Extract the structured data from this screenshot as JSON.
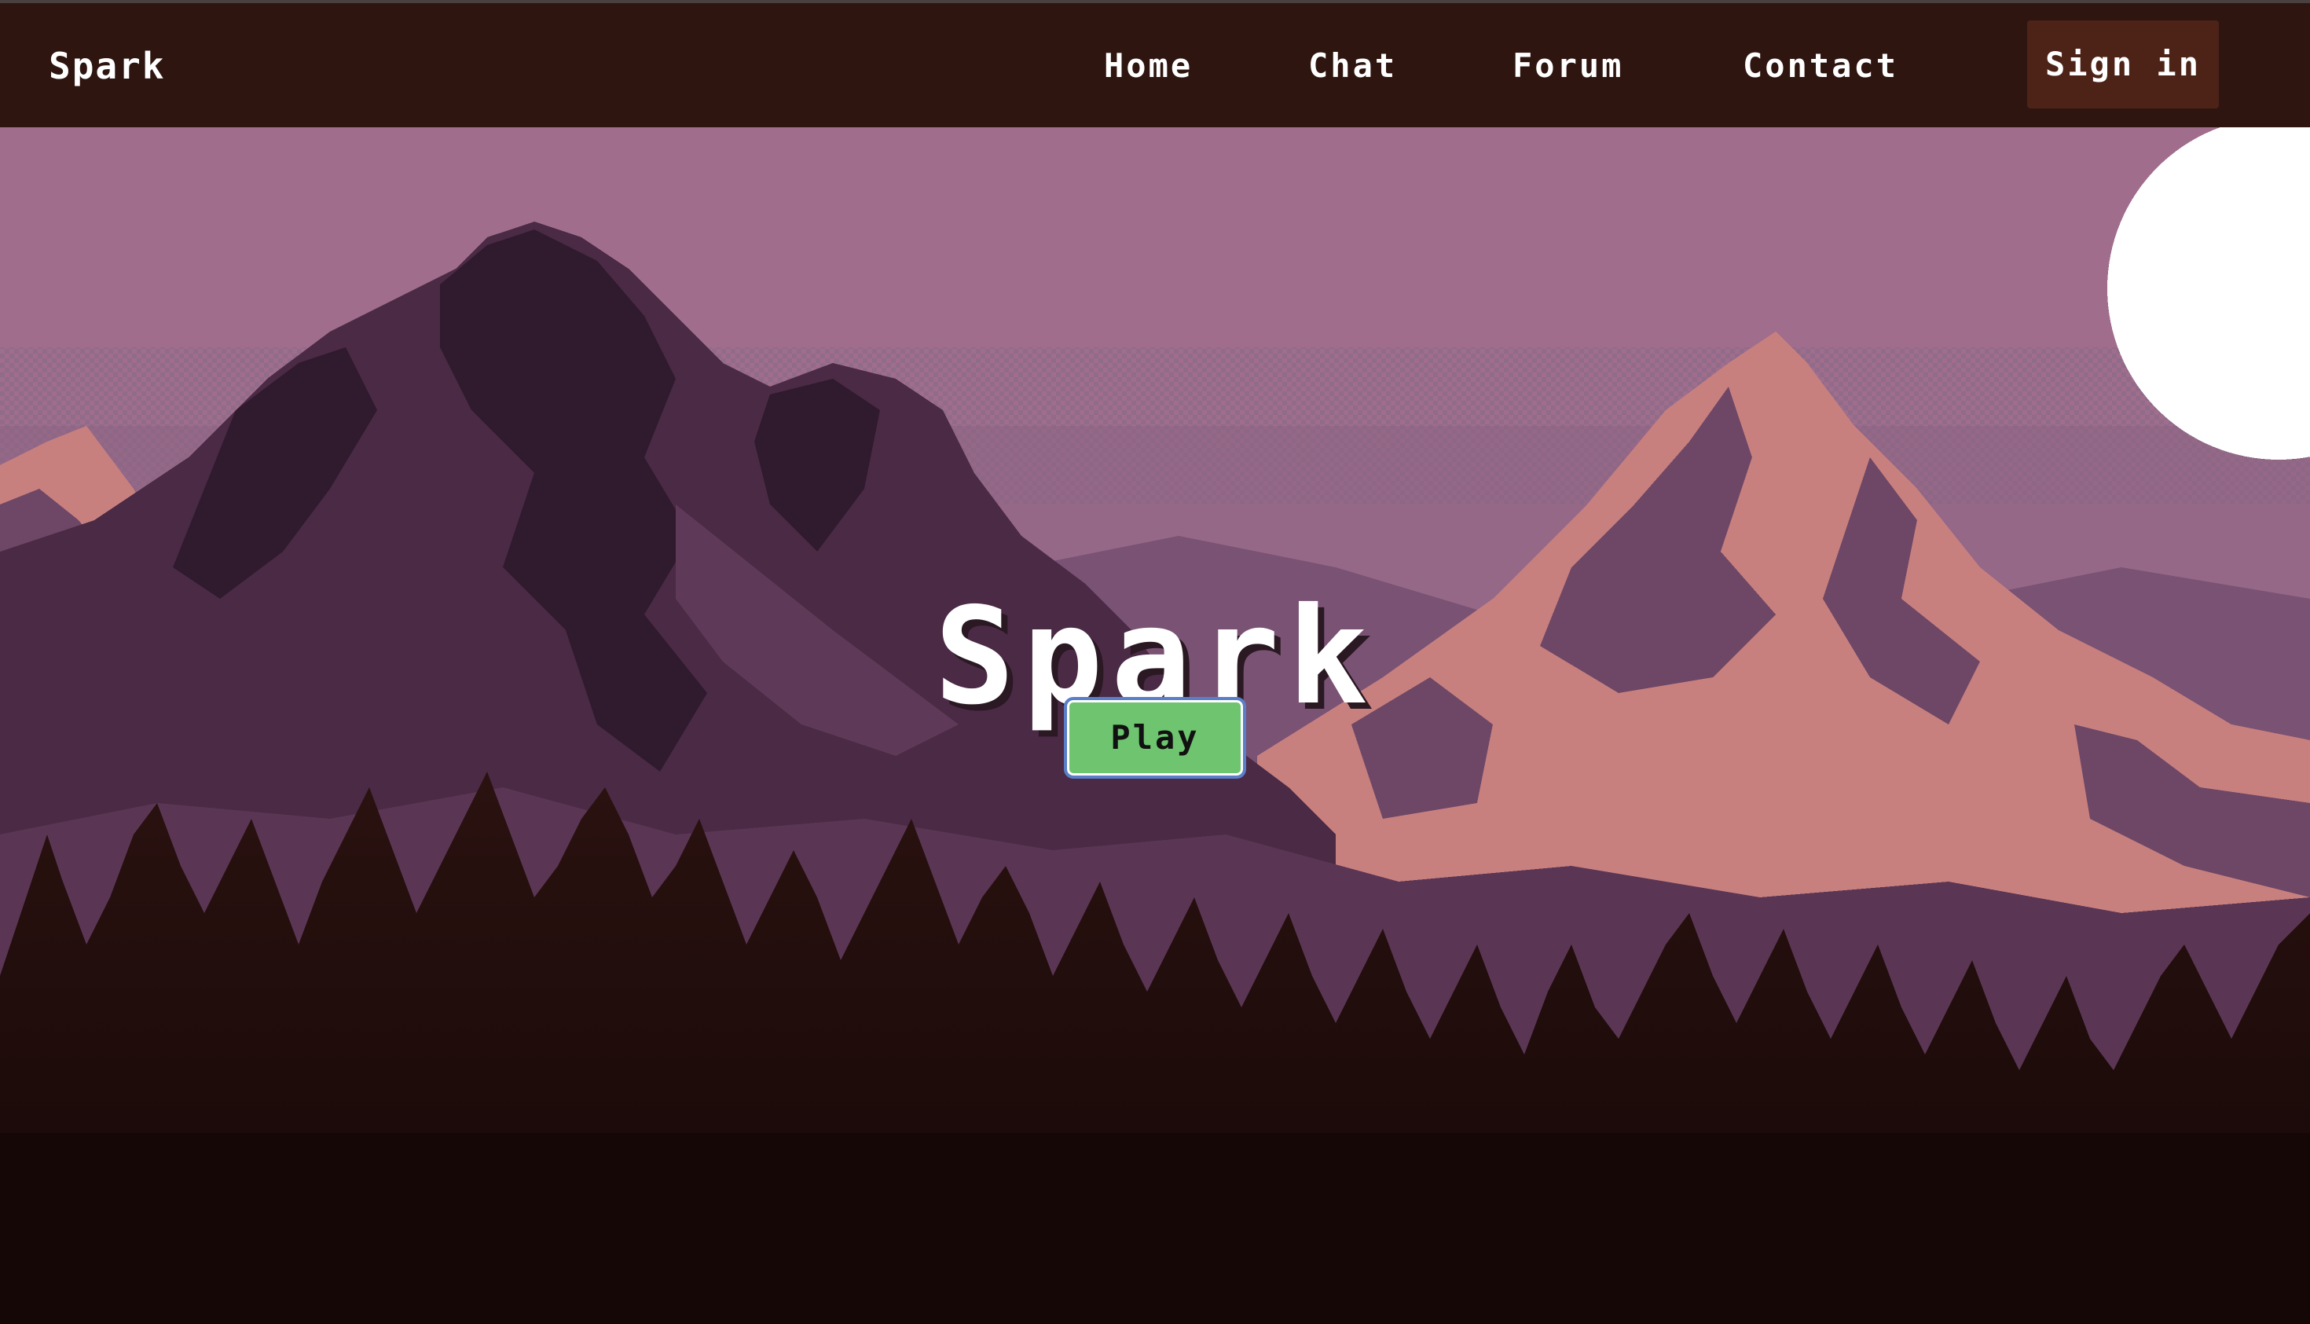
{
  "nav": {
    "brand": "Spark",
    "links": [
      "Home",
      "Chat",
      "Forum",
      "Contact"
    ],
    "signin_label": "Sign in"
  },
  "hero": {
    "title": "Spark",
    "play_label": "Play"
  },
  "colors": {
    "navbar_bg": "#2e1510",
    "signin_bg": "#4d2318",
    "sky": "#a06e8c",
    "mountain_far": "#6e4766",
    "mountain_dark": "#3b2338",
    "mountain_pink": "#c8807f",
    "forest": "#1f0d0b",
    "play_button": "#6ec46f",
    "moon": "#ffffff"
  }
}
